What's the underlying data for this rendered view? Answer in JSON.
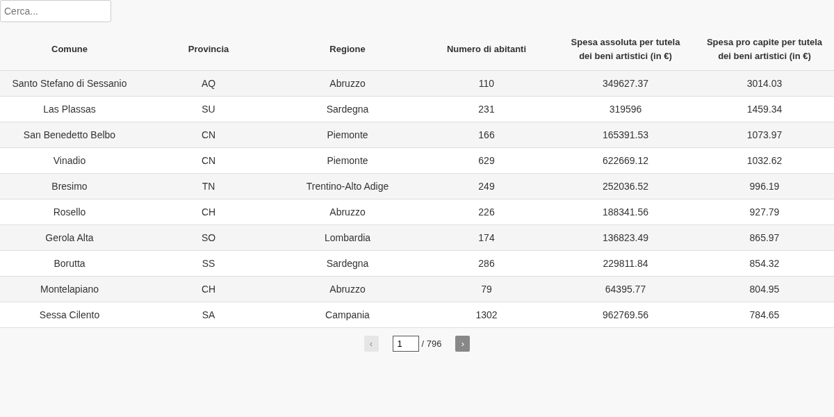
{
  "search": {
    "placeholder": "Cerca..."
  },
  "table": {
    "columns": [
      "Comune",
      "Provincia",
      "Regione",
      "Numero di abitanti",
      "Spesa assoluta per tutela dei beni artistici (in €)",
      "Spesa pro capite per tutela dei beni artistici (in €)"
    ],
    "rows": [
      [
        "Santo Stefano di Sessanio",
        "AQ",
        "Abruzzo",
        "110",
        "349627.37",
        "3014.03"
      ],
      [
        "Las Plassas",
        "SU",
        "Sardegna",
        "231",
        "319596",
        "1459.34"
      ],
      [
        "San Benedetto Belbo",
        "CN",
        "Piemonte",
        "166",
        "165391.53",
        "1073.97"
      ],
      [
        "Vinadio",
        "CN",
        "Piemonte",
        "629",
        "622669.12",
        "1032.62"
      ],
      [
        "Bresimo",
        "TN",
        "Trentino-Alto Adige",
        "249",
        "252036.52",
        "996.19"
      ],
      [
        "Rosello",
        "CH",
        "Abruzzo",
        "226",
        "188341.56",
        "927.79"
      ],
      [
        "Gerola Alta",
        "SO",
        "Lombardia",
        "174",
        "136823.49",
        "865.97"
      ],
      [
        "Borutta",
        "SS",
        "Sardegna",
        "286",
        "229811.84",
        "854.32"
      ],
      [
        "Montelapiano",
        "CH",
        "Abruzzo",
        "79",
        "64395.77",
        "804.95"
      ],
      [
        "Sessa Cilento",
        "SA",
        "Campania",
        "1302",
        "962769.56",
        "784.65"
      ]
    ]
  },
  "pagination": {
    "prev": {
      "label": "‹",
      "disabled": true
    },
    "page": "1",
    "total": "/ 796",
    "next": {
      "label": "›",
      "disabled": false
    }
  }
}
